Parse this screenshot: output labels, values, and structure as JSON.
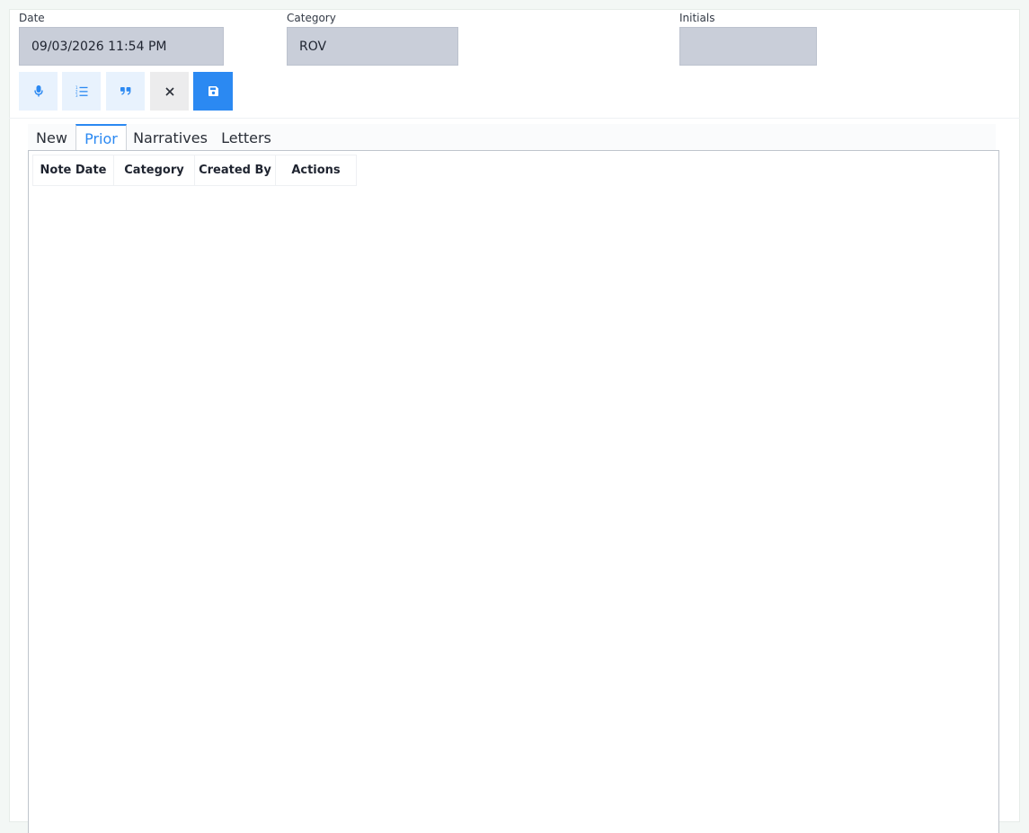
{
  "form": {
    "date": {
      "label": "Date",
      "value": "09/03/2026 11:54 PM"
    },
    "category": {
      "label": "Category",
      "value": "ROV"
    },
    "initials": {
      "label": "Initials",
      "value": ""
    }
  },
  "toolbar": {
    "buttons": [
      {
        "name": "microphone-button",
        "icon": "microphone-icon"
      },
      {
        "name": "numbered-list-button",
        "icon": "numbered-list-icon"
      },
      {
        "name": "quote-button",
        "icon": "quote-icon"
      },
      {
        "name": "cancel-button",
        "icon": "close-icon"
      },
      {
        "name": "save-button",
        "icon": "floppy-disk-icon"
      }
    ]
  },
  "tabs": [
    {
      "label": "New",
      "active": false
    },
    {
      "label": "Prior",
      "active": true
    },
    {
      "label": "Narratives",
      "active": false
    },
    {
      "label": "Letters",
      "active": false
    }
  ],
  "grid": {
    "columns": [
      "Note Date",
      "Category",
      "Created By",
      "Actions"
    ],
    "rows": []
  },
  "colors": {
    "accent": "#2b89f2",
    "field_background": "#c9ced9",
    "tool_button_background": "#e8f2fd",
    "cancel_button_background": "#ececed"
  }
}
